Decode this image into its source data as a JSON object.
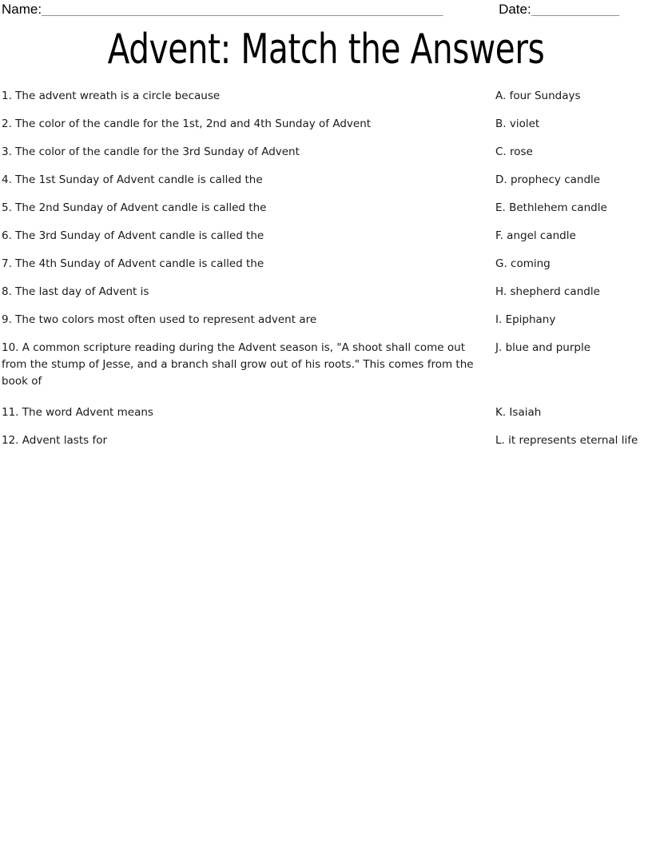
{
  "header": {
    "name_label": "Name:",
    "name_rule": "________________________________________________________________",
    "date_label": "Date:",
    "date_rule": "______________"
  },
  "title": "Advent: Match the Answers",
  "worksheet": {
    "rows": [
      {
        "question": "1. The advent wreath is a circle because",
        "answer": "A. four Sundays"
      },
      {
        "question": "2. The color of the candle for the 1st, 2nd and 4th Sunday of Advent",
        "answer": "B. violet"
      },
      {
        "question": "3. The color of the candle for the 3rd Sunday of Advent",
        "answer": "C. rose"
      },
      {
        "question": "4. The 1st Sunday of Advent candle is called the",
        "answer": "D. prophecy candle"
      },
      {
        "question": "5. The 2nd Sunday of Advent candle is called the",
        "answer": "E. Bethlehem candle"
      },
      {
        "question": "6. The 3rd Sunday of Advent candle is called the",
        "answer": "F. angel candle"
      },
      {
        "question": "7. The 4th Sunday of Advent candle is called the",
        "answer": "G. coming"
      },
      {
        "question": "8. The last day of Advent is",
        "answer": "H. shepherd candle"
      },
      {
        "question": "9. The two colors most often used to represent advent are",
        "answer": "I. Epiphany"
      },
      {
        "question": "10. A common scripture reading during the Advent season is, \"A shoot shall come out from the stump of Jesse, and a branch shall grow out of his roots.\" This comes from the book of",
        "answer": "J. blue and purple"
      },
      {
        "question": "11. The word Advent means",
        "answer": "K. Isaiah"
      },
      {
        "question": "12. Advent lasts for",
        "answer": "L. it represents eternal life"
      }
    ]
  }
}
